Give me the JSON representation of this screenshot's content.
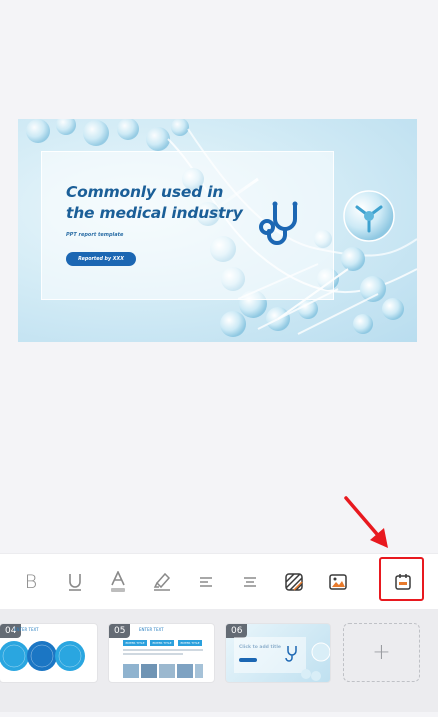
{
  "slide": {
    "title": "Commonly used in the medical industry",
    "subtitle": "PPT report template",
    "button_label": "Reported by XXX"
  },
  "toolbar": {
    "items": [
      {
        "name": "bold",
        "icon": "bold-icon",
        "glyph": "B"
      },
      {
        "name": "underline",
        "icon": "underline-icon",
        "glyph": "U"
      },
      {
        "name": "font-color",
        "icon": "font-color-icon",
        "glyph": "A"
      },
      {
        "name": "highlight",
        "icon": "highlighter-icon"
      },
      {
        "name": "align-left",
        "icon": "align-left-icon"
      },
      {
        "name": "align-center",
        "icon": "align-center-icon"
      },
      {
        "name": "fill",
        "icon": "fill-pattern-icon"
      },
      {
        "name": "image",
        "icon": "image-icon"
      },
      {
        "name": "slide-layout",
        "icon": "slide-layout-icon"
      }
    ],
    "accent_color": "#e8191f"
  },
  "thumbnails": [
    {
      "number": "04",
      "label": "ENTER TEXT"
    },
    {
      "number": "05",
      "label": "ENTER TEXT",
      "chips": [
        "ENTER TITLE",
        "ENTER TITLE",
        "ENTER TITLE"
      ]
    },
    {
      "number": "06",
      "label": "Click to add title"
    }
  ],
  "add_slide": {
    "label": "+"
  },
  "colors": {
    "brand_blue": "#1c67b3",
    "title_blue": "#1b5f98",
    "annotation_red": "#e8191f"
  }
}
